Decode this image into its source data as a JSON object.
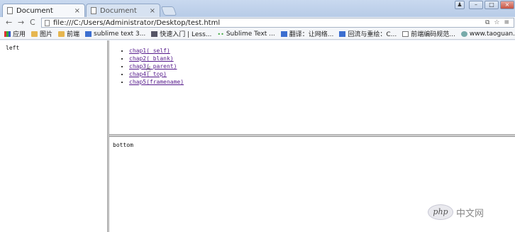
{
  "tabs": [
    {
      "title": "Document",
      "close": "×"
    },
    {
      "title": "Document",
      "close": "×"
    }
  ],
  "window_controls": {
    "user": "♟",
    "min": "–",
    "max": "□",
    "close": "×"
  },
  "toolbar": {
    "back": "←",
    "forward": "→",
    "reload": "C"
  },
  "url": {
    "value": "file:///C:/Users/Administrator/Desktop/test.html",
    "right_icons": [
      "⧉",
      "☆",
      "≡"
    ]
  },
  "bookmarks": [
    {
      "label": "应用",
      "icon": "apps-icon"
    },
    {
      "label": "图片",
      "icon": "folder-icon"
    },
    {
      "label": "前端",
      "icon": "folder-icon"
    },
    {
      "label": "sublime text 3...",
      "icon": "site-icon"
    },
    {
      "label": "快速入门 | Less...",
      "icon": "mail-icon"
    },
    {
      "label": "Sublime Text ...",
      "icon": "dots-icon"
    },
    {
      "label": "翻译：让网络...",
      "icon": "site-icon"
    },
    {
      "label": "回流与重绘：C...",
      "icon": "site-icon"
    },
    {
      "label": "前端编码规范...",
      "icon": "doc-icon"
    },
    {
      "label": "www.taoguan...",
      "icon": "globe-icon"
    }
  ],
  "frames": {
    "left_text": "left",
    "bottom_text": "bottom",
    "links": [
      "chap1(_self)",
      "chap2(_blank)",
      "chap3(_parent)",
      "chap4(_top)",
      "chap5(framename)"
    ]
  },
  "watermark": {
    "logo": "php",
    "text": "中文网"
  }
}
